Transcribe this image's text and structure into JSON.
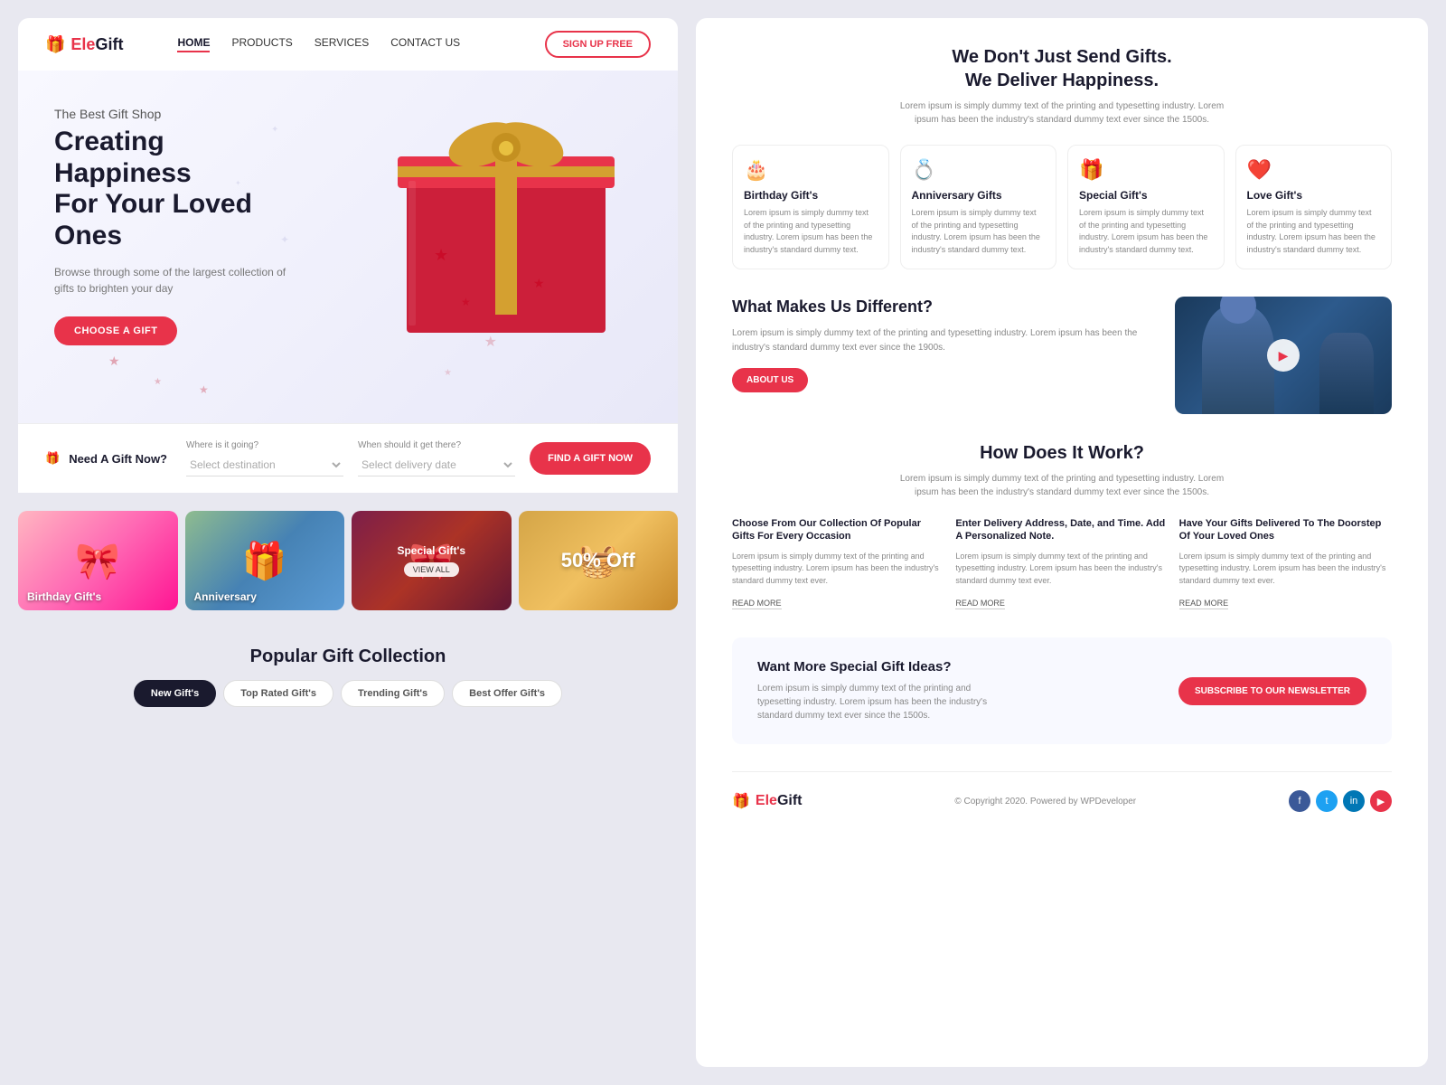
{
  "brand": {
    "name_prefix": "Ele",
    "name_suffix": "Gift",
    "logo_symbol": "🎁"
  },
  "navbar": {
    "links": [
      {
        "label": "HOME",
        "active": true
      },
      {
        "label": "PRODUCTS",
        "active": false
      },
      {
        "label": "SERVICES",
        "active": false
      },
      {
        "label": "CONTACT US",
        "active": false
      }
    ],
    "signup_label": "SIGN UP FREE"
  },
  "hero": {
    "subtitle": "The Best Gift Shop",
    "title_line1": "Creating Happiness",
    "title_line2": "For Your Loved Ones",
    "description": "Browse through some of the largest collection of gifts to brighten your day",
    "cta_label": "CHOOSE A GIFT"
  },
  "search": {
    "need_label": "Need A Gift Now?",
    "destination_label": "Where is it going?",
    "destination_placeholder": "Select destination",
    "delivery_label": "When should it get there?",
    "delivery_placeholder": "Select delivery date",
    "find_label": "FIND A GIFT NOW"
  },
  "categories": [
    {
      "label": "Birthday Gift's",
      "bg_class": "cat-bg-1"
    },
    {
      "label": "Anniversary",
      "bg_class": "cat-bg-2"
    },
    {
      "label": "Special Gift's",
      "bg_class": "cat-bg-3",
      "has_overlay": true
    },
    {
      "label": "50% Off",
      "bg_class": "cat-bg-4",
      "has_discount": true
    }
  ],
  "popular": {
    "title": "Popular Gift Collection",
    "tabs": [
      "New Gift's",
      "Top Rated Gift's",
      "Trending Gift's",
      "Best Offer Gift's"
    ],
    "active_tab": 0
  },
  "right": {
    "hero_title_line1": "We Don't Just Send Gifts.",
    "hero_title_line2": "We Deliver Happiness.",
    "hero_desc": "Lorem ipsum is simply dummy text of the printing and typesetting industry. Lorem ipsum has been the industry's standard dummy text ever since the 1500s.",
    "feature_cards": [
      {
        "icon": "🎂",
        "title": "Birthday Gift's",
        "desc": "Lorem ipsum is simply dummy text of the printing and typesetting industry. Lorem ipsum has been the industry's standard dummy text."
      },
      {
        "icon": "💍",
        "title": "Anniversary Gifts",
        "desc": "Lorem ipsum is simply dummy text of the printing and typesetting industry. Lorem ipsum has been the industry's standard dummy text."
      },
      {
        "icon": "🎁",
        "title": "Special Gift's",
        "desc": "Lorem ipsum is simply dummy text of the printing and typesetting industry. Lorem ipsum has been the industry's standard dummy text."
      },
      {
        "icon": "❤️",
        "title": "Love Gift's",
        "desc": "Lorem ipsum is simply dummy text of the printing and typesetting industry. Lorem ipsum has been the industry's standard dummy text."
      }
    ],
    "different": {
      "title": "What Makes Us Different?",
      "desc": "Lorem ipsum is simply dummy text of the printing and typesetting industry. Lorem ipsum has been the industry's standard dummy text ever since the 1900s.",
      "btn_label": "ABOUT US"
    },
    "how": {
      "title": "How Does It Work?",
      "desc": "Lorem ipsum is simply dummy text of the printing and typesetting industry. Lorem ipsum has been the industry's standard dummy text ever since the 1500s.",
      "steps": [
        {
          "title": "Choose From Our Collection Of Popular Gifts For Every Occasion",
          "desc": "Lorem ipsum is simply dummy text of the printing and typesetting industry. Lorem ipsum has been the industry's standard dummy text ever.",
          "link": "READ MORE"
        },
        {
          "title": "Enter Delivery Address, Date, and Time. Add A Personalized Note.",
          "desc": "Lorem ipsum is simply dummy text of the printing and typesetting industry. Lorem ipsum has been the industry's standard dummy text ever.",
          "link": "READ MORE"
        },
        {
          "title": "Have Your Gifts Delivered To The Doorstep Of Your Loved Ones",
          "desc": "Lorem ipsum is simply dummy text of the printing and typesetting industry. Lorem ipsum has been the industry's standard dummy text ever.",
          "link": "READ MORE"
        }
      ]
    },
    "newsletter": {
      "title": "Want More Special Gift Ideas?",
      "desc": "Lorem ipsum is simply dummy text of the printing and typesetting industry. Lorem ipsum has been the industry's standard dummy text ever since the 1500s.",
      "btn_label": "SUBSCRIBE TO OUR NEWSLETTER"
    },
    "footer": {
      "copyright": "© Copyright 2020. Powered by WPDeveloper"
    }
  }
}
